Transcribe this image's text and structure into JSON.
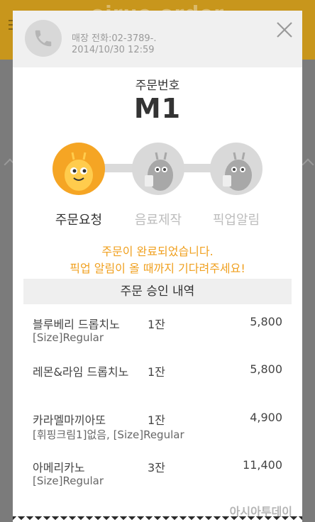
{
  "background": {
    "logo_text": "ojrue order"
  },
  "dialog": {
    "store_phone": "매장 전화:02-3789-.",
    "order_date": "2014/10/30 12:59",
    "order_number_label": "주문번호",
    "order_number": "M1",
    "steps": [
      {
        "label": "주문요청",
        "active": true
      },
      {
        "label": "음료제작",
        "active": false
      },
      {
        "label": "픽업알림",
        "active": false
      }
    ],
    "message_line1": "주문이 완료되었습니다.",
    "message_line2": "픽업 알림이 올 때까지 기다려주세요!",
    "section_title": "주문 승인 내역",
    "items": [
      {
        "name": "블루베리 드롭치노",
        "option": "[Size]Regular",
        "qty": "1잔",
        "price": "5,800"
      },
      {
        "name": "레몬&라임 드롭치노",
        "option": "",
        "qty": "1잔",
        "price": "5,800"
      },
      {
        "name": "카라멜마끼아또",
        "option": "[휘핑크림1]없음, [Size]Regular",
        "qty": "1잔",
        "price": "4,900"
      },
      {
        "name": "아메리카노",
        "option": "[Size]Regular",
        "qty": "3잔",
        "price": "11,400"
      }
    ]
  },
  "watermark": "아시아투데이",
  "colors": {
    "accent": "#f5a524",
    "header_bg": "#c8961c",
    "inactive_step": "#d9d9d9"
  }
}
